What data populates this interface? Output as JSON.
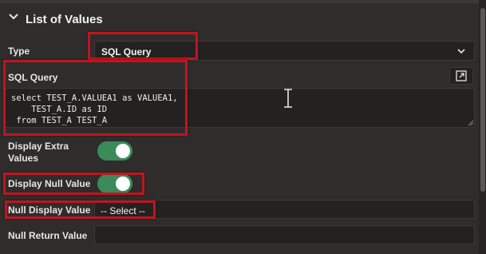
{
  "section": {
    "title": "List of Values",
    "icon": "chevron-down-icon"
  },
  "type_field": {
    "label": "Type",
    "value": "SQL Query"
  },
  "sql_query": {
    "label": "SQL Query",
    "code": "select TEST_A.VALUEA1 as VALUEA1,\n    TEST_A.ID as ID\n from TEST_A TEST_A",
    "expand_icon": "expand-icon"
  },
  "display_extra_values": {
    "label_line1": "Display Extra",
    "label_line2": "Values",
    "on": true
  },
  "display_null_value": {
    "label": "Display Null Value",
    "on": true
  },
  "null_display_value": {
    "label": "Null Display Value",
    "value": "-- Select --"
  },
  "null_return_value": {
    "label": "Null Return Value",
    "value": ""
  },
  "colors": {
    "background": "#2e2d2c",
    "field": "#232221",
    "toggle_on": "#3a8a5a",
    "highlight": "#c0151f"
  }
}
